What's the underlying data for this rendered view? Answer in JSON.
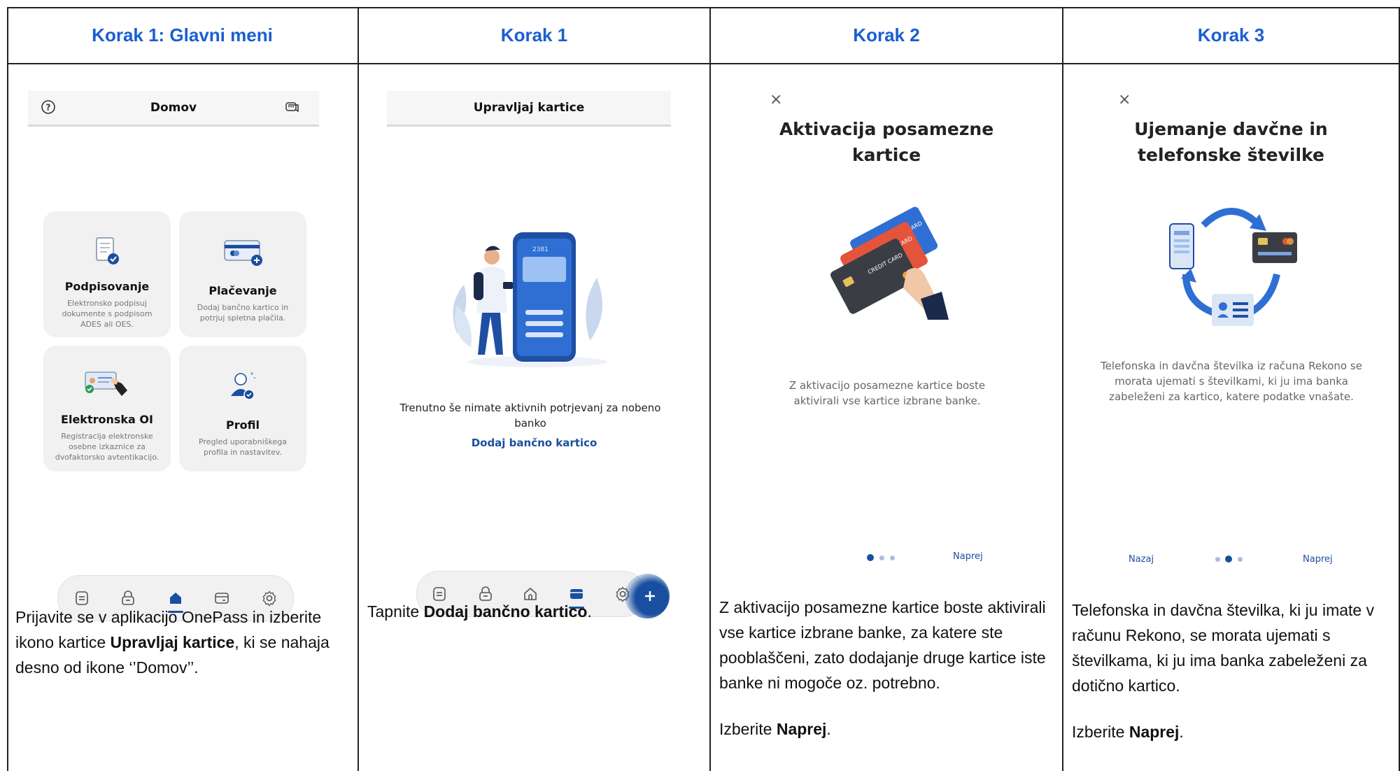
{
  "columns": [
    {
      "header": "Korak 1: Glavni meni",
      "screen": {
        "title": "Domov",
        "tiles": [
          {
            "title": "Podpisovanje",
            "desc": "Elektronsko podpisuj dokumente s podpisom ADES ali OES."
          },
          {
            "title": "Plačevanje",
            "desc": "Dodaj bančno kartico in potrjuj spletna plačila."
          },
          {
            "title": "Elektronska OI",
            "desc": "Registracija elektronske osebne izkaznice za dvofaktorsko avtentikacijo."
          },
          {
            "title": "Profil",
            "desc": "Pregled uporabniškega profila in nastavitev."
          }
        ]
      },
      "caption": {
        "p1": "Prijavite se v aplikacijo OnePass in izberite ikono kartice ",
        "b1": "Upravljaj kartice",
        "p2": ", ki se nahaja desno od ikone ‘’Domov’’."
      }
    },
    {
      "header": "Korak 1",
      "screen": {
        "title": "Upravljaj kartice",
        "empty_text": "Trenutno še nimate aktivnih potrjevanj za nobeno banko",
        "add_link": "Dodaj bančno kartico",
        "phone_label": "2381",
        "dot_text": "."
      },
      "caption": {
        "p1": "Tapnite ",
        "b1": "Dodaj bančno kartico",
        "p2": "."
      }
    },
    {
      "header": "Korak 2",
      "screen": {
        "close": "×",
        "title": "Aktivacija posamezne kartice",
        "text": "Z aktivacijo posamezne kartice boste aktivirali vse kartice izbrane banke.",
        "next": "Naprej",
        "card_label": "CREDIT CARD"
      },
      "caption": {
        "p1": "Z aktivacijo posamezne kartice boste aktivirali vse kartice izbrane banke, za katere ste pooblaščeni, zato dodajanje druge kartice iste banke ni mogoče oz. potrebno.",
        "p2": "Izberite ",
        "b2": "Naprej",
        "p3": "."
      }
    },
    {
      "header": "Korak 3",
      "screen": {
        "close": "×",
        "title": "Ujemanje davčne in telefonske številke",
        "text": "Telefonska in davčna številka iz računa Rekono se morata ujemati s številkami, ki ju ima banka zabeleženi za kartico, katere podatke vnašate.",
        "back": "Nazaj",
        "next": "Naprej"
      },
      "caption": {
        "p1": "Telefonska in davčna številka, ki ju imate v računu Rekono, se morata ujemati s številkama, ki ju ima banka zabeleženi za dotično kartico.",
        "p2": "Izberite ",
        "b2": "Naprej",
        "p3": "."
      }
    }
  ],
  "colors": {
    "header_blue": "#1a5fd1",
    "link_blue": "#1a4fa0",
    "accent": "#2f6fd3"
  }
}
